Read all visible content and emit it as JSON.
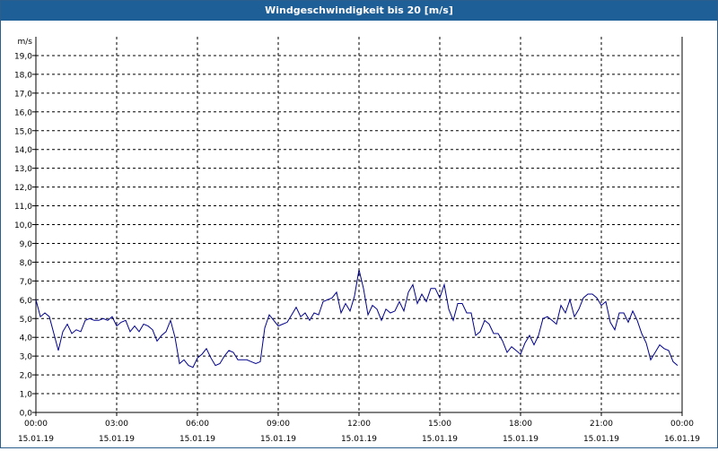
{
  "title": "Windgeschwindigkeit bis 20 [m/s]",
  "colors": {
    "titlebar": "#1f5f97",
    "line": "#00008b",
    "grid": "#000000"
  },
  "chart_data": {
    "type": "line",
    "title": "Windgeschwindigkeit bis 20 [m/s]",
    "ylabel": "m/s",
    "xlabel": "",
    "ylim": [
      0,
      20
    ],
    "yticks": [
      "0,0",
      "1,0",
      "2,0",
      "3,0",
      "4,0",
      "5,0",
      "6,0",
      "7,0",
      "8,0",
      "9,0",
      "10,0",
      "11,0",
      "12,0",
      "13,0",
      "14,0",
      "15,0",
      "16,0",
      "17,0",
      "18,0",
      "19,0"
    ],
    "xlim_hours": [
      0,
      24
    ],
    "xticks": [
      {
        "time": "00:00",
        "date": "15.01.19"
      },
      {
        "time": "03:00",
        "date": "15.01.19"
      },
      {
        "time": "06:00",
        "date": "15.01.19"
      },
      {
        "time": "09:00",
        "date": "15.01.19"
      },
      {
        "time": "12:00",
        "date": "15.01.19"
      },
      {
        "time": "15:00",
        "date": "15.01.19"
      },
      {
        "time": "18:00",
        "date": "15.01.19"
      },
      {
        "time": "21:00",
        "date": "15.01.19"
      },
      {
        "time": "00:00",
        "date": "16.01.19"
      }
    ],
    "grid": true,
    "series": [
      {
        "x": [
          "00:00",
          "00:10",
          "00:20",
          "00:30",
          "00:40",
          "00:50",
          "01:00",
          "01:10",
          "01:20",
          "01:30",
          "01:40",
          "01:50",
          "02:00",
          "02:10",
          "02:20",
          "02:30",
          "02:40",
          "02:50",
          "03:00",
          "03:10",
          "03:20",
          "03:30",
          "03:40",
          "03:50",
          "04:00",
          "04:10",
          "04:20",
          "04:30",
          "04:40",
          "04:50",
          "05:00",
          "05:10",
          "05:20",
          "05:30",
          "05:40",
          "05:50",
          "06:00",
          "06:10",
          "06:20",
          "06:30",
          "06:40",
          "06:50",
          "07:00",
          "07:10",
          "07:20",
          "07:30",
          "07:40",
          "07:50",
          "08:00",
          "08:10",
          "08:20",
          "08:30",
          "08:40",
          "08:50",
          "09:00",
          "09:10",
          "09:20",
          "09:30",
          "09:40",
          "09:50",
          "10:00",
          "10:10",
          "10:20",
          "10:30",
          "10:40",
          "10:50",
          "11:00",
          "11:10",
          "11:20",
          "11:30",
          "11:40",
          "11:50",
          "12:00",
          "12:10",
          "12:20",
          "12:30",
          "12:40",
          "12:50",
          "13:00",
          "13:10",
          "13:20",
          "13:30",
          "13:40",
          "13:50",
          "14:00",
          "14:10",
          "14:20",
          "14:30",
          "14:40",
          "14:50",
          "15:00",
          "15:10",
          "15:20",
          "15:30",
          "15:40",
          "15:50",
          "16:00",
          "16:10",
          "16:20",
          "16:30",
          "16:40",
          "16:50",
          "17:00",
          "17:10",
          "17:20",
          "17:30",
          "17:40",
          "17:50",
          "18:00",
          "18:10",
          "18:20",
          "18:30",
          "18:40",
          "18:50",
          "19:00",
          "19:10",
          "19:20",
          "19:30",
          "19:40",
          "19:50",
          "20:00",
          "20:10",
          "20:20",
          "20:30",
          "20:40",
          "20:50",
          "21:00",
          "21:10",
          "21:20",
          "21:30",
          "21:40",
          "21:50",
          "22:00",
          "22:10",
          "22:20",
          "22:30",
          "22:40",
          "22:50",
          "23:00",
          "23:10",
          "23:20",
          "23:30",
          "23:40",
          "23:50"
        ],
        "values": [
          6.0,
          5.1,
          5.3,
          5.1,
          4.2,
          3.3,
          4.3,
          4.7,
          4.2,
          4.4,
          4.3,
          4.9,
          5.0,
          4.9,
          4.9,
          5.0,
          4.9,
          5.1,
          4.6,
          4.8,
          4.9,
          4.3,
          4.6,
          4.3,
          4.7,
          4.6,
          4.4,
          3.8,
          4.1,
          4.3,
          4.9,
          4.0,
          2.6,
          2.8,
          2.5,
          2.4,
          2.9,
          3.1,
          3.4,
          2.9,
          2.5,
          2.6,
          3.0,
          3.3,
          3.2,
          2.8,
          2.8,
          2.8,
          2.7,
          2.6,
          2.7,
          4.5,
          5.2,
          4.9,
          4.6,
          4.7,
          4.8,
          5.2,
          5.6,
          5.1,
          5.3,
          4.9,
          5.3,
          5.2,
          5.9,
          6.0,
          6.1,
          6.4,
          5.3,
          5.8,
          5.4,
          6.2,
          7.6,
          6.6,
          5.2,
          5.7,
          5.5,
          4.9,
          5.5,
          5.3,
          5.4,
          5.9,
          5.4,
          6.4,
          6.8,
          5.8,
          6.3,
          5.9,
          6.6,
          6.6,
          6.1,
          6.8,
          5.5,
          4.9,
          5.8,
          5.8,
          5.3,
          5.3,
          4.1,
          4.3,
          4.9,
          4.7,
          4.2,
          4.2,
          3.8,
          3.2,
          3.5,
          3.3,
          3.1,
          3.7,
          4.1,
          3.6,
          4.1,
          5.0,
          5.1,
          4.9,
          4.7,
          5.7,
          5.3,
          6.0,
          5.1,
          5.5,
          6.1,
          6.3,
          6.3,
          6.1,
          5.7,
          5.9,
          4.8,
          4.4,
          5.3,
          5.3,
          4.8,
          5.4,
          4.9,
          4.2,
          3.7,
          2.8,
          3.2,
          3.6,
          3.4,
          3.3,
          2.7,
          2.5
        ]
      }
    ]
  }
}
